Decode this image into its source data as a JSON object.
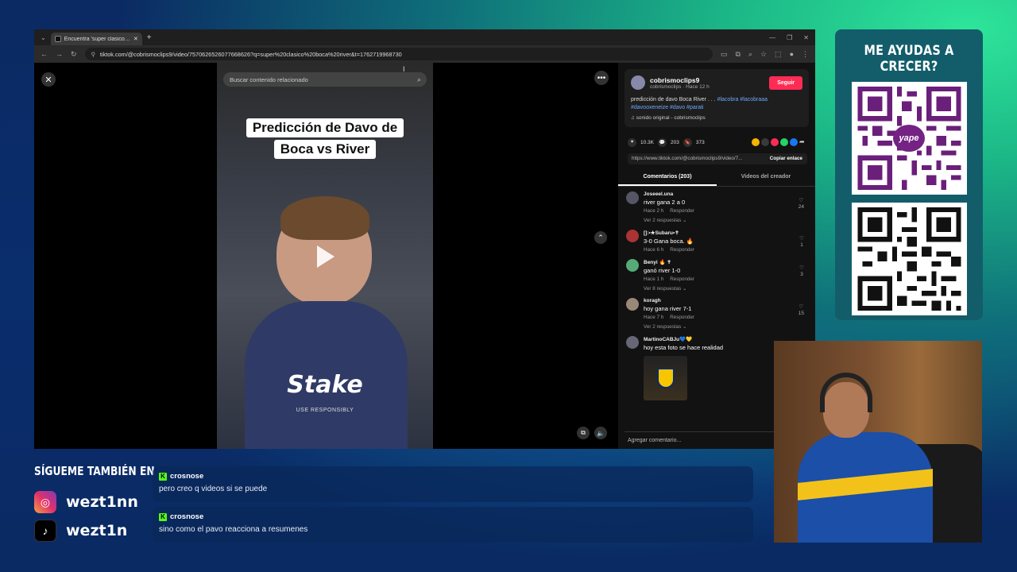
{
  "browser": {
    "tab_title": "Encuentra 'super clasico boca",
    "url": "tiktok.com/@cobrismoclips9/video/7570626526077668626?q=super%20clasico%20boca%20river&t=1762719968730"
  },
  "video": {
    "search_placeholder": "Buscar contenido relacionado",
    "caption_line1": "Predicción de Davo de",
    "caption_line2": "Boca vs River",
    "sponsor": "Stake",
    "sponsor_sub": "USE RESPONSIBLY"
  },
  "post": {
    "username": "cobrismoclips9",
    "subline": "cobrismoclips · Hace 12 h",
    "follow_label": "Seguir",
    "description": "predicción de davo Boca River . . .",
    "tags": "#lacobra #lacobraaa #davooxeneize #davo #parati",
    "sound": "♫ sonido original - cobrismoclips",
    "likes": "10.3K",
    "comments_count": "203",
    "saves": "373",
    "link": "https://www.tiktok.com/@cobrismoclips9/video/7...",
    "copy_label": "Copiar enlace",
    "tab_comments": "Comentarios (203)",
    "tab_creator": "Videos del creador",
    "add_comment": "Agregar comentario..."
  },
  "comments": [
    {
      "user": "Joseeel.una",
      "text": "river gana 2 a 0",
      "time": "Hace 2 h",
      "reply": "Responder",
      "likes": "24",
      "more": "Ver 2 respuestas ⌄"
    },
    {
      "user": "[]:•★Subaru•✝",
      "text": "3-0 Gana boca. 🔥",
      "time": "Hace 6 h",
      "reply": "Responder",
      "likes": "1",
      "more": ""
    },
    {
      "user": "Benyi 🔥 ✝",
      "text": "ganó river 1-0",
      "time": "Hace 1 h",
      "reply": "Responder",
      "likes": "3",
      "more": "Ver 8 respuestas ⌄"
    },
    {
      "user": "koragh",
      "text": "hoy gana river 7-1",
      "time": "Hace 7 h",
      "reply": "Responder",
      "likes": "15",
      "more": "Ver 2 respuestas ⌄"
    },
    {
      "user": "MartinoCABJu💙💛",
      "text": "hoy esta foto se hace realidad",
      "time": "",
      "reply": "",
      "likes": "",
      "more": ""
    }
  ],
  "sidebar": {
    "qr_title": "ME AYUDAS A CRECER?",
    "yape": "yape"
  },
  "socials": {
    "title": "SÍGUEME TAMBIÉN EN",
    "instagram": "wezt1nn",
    "tiktok": "wezt1n"
  },
  "chat": [
    {
      "user": "crosnose",
      "message": "pero creo q videos si se puede"
    },
    {
      "user": "crosnose",
      "message": "sino como el pavo reacciona a resumenes"
    }
  ]
}
